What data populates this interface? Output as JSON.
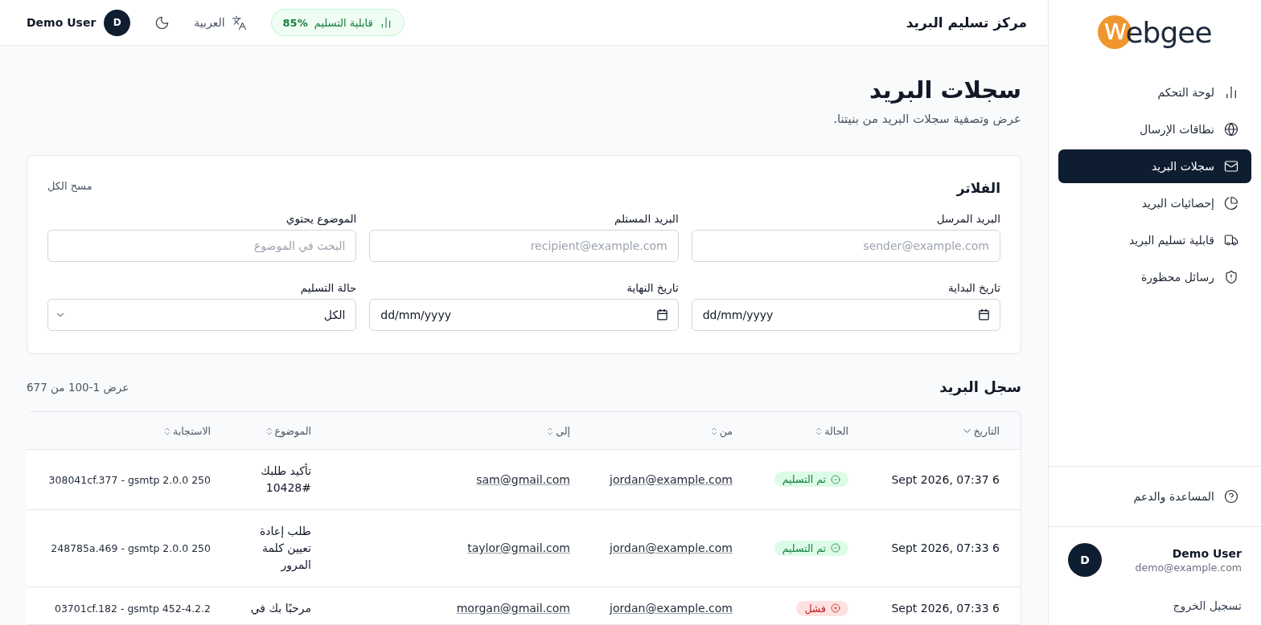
{
  "sidebar": {
    "logo": {
      "mark": "w",
      "text": "ebgee"
    },
    "items": [
      {
        "label": "لوحة التحكم",
        "selected": false
      },
      {
        "label": "نطاقات الإرسال",
        "selected": false
      },
      {
        "label": "سجلات البريد",
        "selected": true
      },
      {
        "label": "إحصائيات البريد",
        "selected": false
      },
      {
        "label": "قابلية تسليم البريد",
        "selected": false
      },
      {
        "label": "رسائل محظورة",
        "selected": false
      }
    ],
    "help": {
      "label": "المساعدة والدعم"
    },
    "user": {
      "avatar": "D",
      "name": "Demo User",
      "email": "demo@example.com"
    },
    "logout": "تسجيل الخروج"
  },
  "header": {
    "title": "مركز تسليم البريد",
    "deliverability": {
      "label": "قابلية التسليم",
      "value": "85%"
    },
    "language": "العربية",
    "user": {
      "avatar": "D",
      "name": "Demo User"
    }
  },
  "page": {
    "title": "سجلات البريد",
    "subtitle": "عرض وتصفية سجلات البريد من بنيتنا."
  },
  "filters": {
    "title": "الفلاتر",
    "clear": "مسح الكل",
    "fields": [
      {
        "kind": "text",
        "label": "البريد المرسل",
        "placeholder": "sender@example.com"
      },
      {
        "kind": "text",
        "label": "البريد المستلم",
        "placeholder": "recipient@example.com"
      },
      {
        "kind": "text",
        "label": "الموضوع يحتوي",
        "placeholder": "البحث في الموضوع"
      },
      {
        "kind": "date",
        "label": "تاريخ البداية",
        "placeholder": "dd/mm/yyyy"
      },
      {
        "kind": "date",
        "label": "تاريخ النهاية",
        "placeholder": "dd/mm/yyyy"
      },
      {
        "kind": "select",
        "label": "حالة التسليم",
        "value": "الكل"
      }
    ]
  },
  "log": {
    "title": "سجل البريد",
    "count": "عرض 1-100 من 677",
    "columns": [
      {
        "label": "التاريخ",
        "sorted": true
      },
      {
        "label": "الحالة",
        "sorted": false
      },
      {
        "label": "من",
        "sorted": false
      },
      {
        "label": "إلى",
        "sorted": false
      },
      {
        "label": "الموضوع",
        "sorted": false
      },
      {
        "label": "الاستجابة",
        "sorted": false
      }
    ],
    "rows": [
      {
        "date": "6 Sept 2026, 07:37",
        "status": {
          "kind": "delivered",
          "label": "تم التسليم"
        },
        "from": "jordan@example.com",
        "to": "sam@gmail.com",
        "subject": "تأكيد طلبك #10428",
        "response": "308041cf.377 - gsmtp 2.0.0 250"
      },
      {
        "date": "6 Sept 2026, 07:33",
        "status": {
          "kind": "delivered",
          "label": "تم التسليم"
        },
        "from": "jordan@example.com",
        "to": "taylor@gmail.com",
        "subject": "طلب إعادة تعيين كلمة المرور",
        "response": "248785a.469 - gsmtp 2.0.0 250"
      },
      {
        "date": "6 Sept 2026, 07:33",
        "status": {
          "kind": "failed",
          "label": "فشل"
        },
        "from": "jordan@example.com",
        "to": "morgan@gmail.com",
        "subject": "مرحبًا بك في",
        "response": "03701cf.182 - gsmtp 452-4.2.2"
      }
    ]
  }
}
